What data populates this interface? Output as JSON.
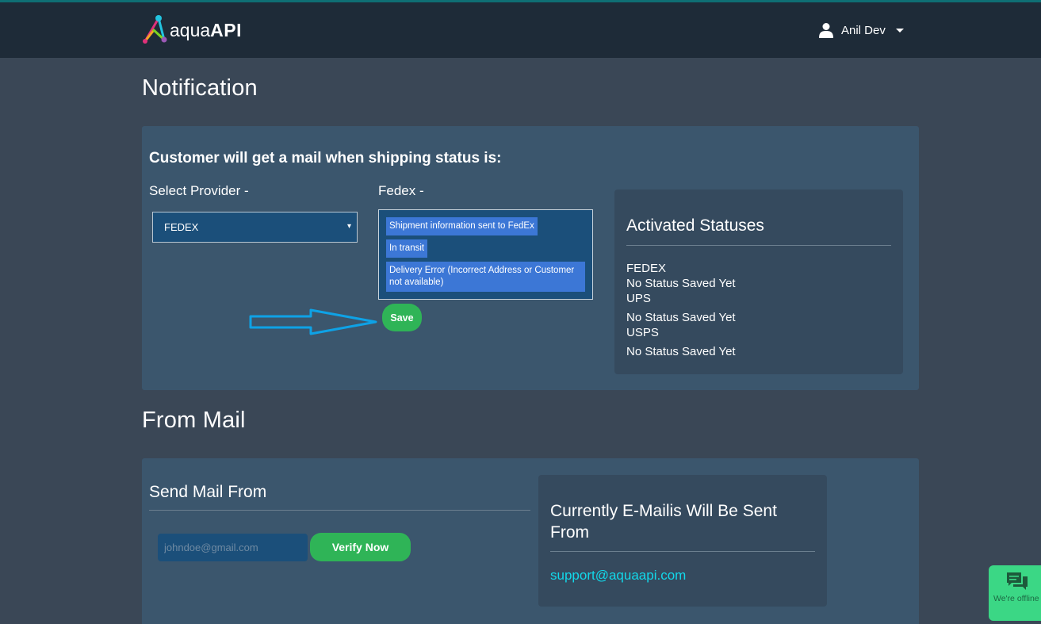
{
  "header": {
    "logo": {
      "prefix": "aqua",
      "suffix": "API"
    },
    "user": {
      "name": "Anil Dev"
    }
  },
  "notification": {
    "heading": "Notification",
    "prompt": "Customer will get a mail when shipping status is:",
    "provider_label": "Select Provider -",
    "provider_selected": "FEDEX",
    "provider_arrow": "▾",
    "statuses_label": "Fedex -",
    "status_options": [
      "Shipment information sent to FedEx",
      "In transit",
      "Delivery Error (Incorrect Address or Customer not available)"
    ],
    "save_label": "Save",
    "activated": {
      "heading": "Activated Statuses",
      "providers": [
        {
          "name": "FEDEX",
          "status": "No Status Saved Yet"
        },
        {
          "name": "UPS",
          "status": "No Status Saved Yet"
        },
        {
          "name": "USPS",
          "status": "No Status Saved Yet"
        }
      ]
    }
  },
  "from_mail": {
    "heading": "From Mail",
    "send_title": "Send Mail From",
    "email_placeholder": "johndoe@gmail.com",
    "verify_label": "Verify Now",
    "current_heading": "Currently E-Mailis Will Be Sent From",
    "current_email": "support@aquaapi.com"
  },
  "chat": {
    "status_text": "We're offline"
  },
  "colors": {
    "accent_green": "#2fb457",
    "link_cyan": "#12d8ea",
    "annotation_arrow": "#0ea2e6",
    "chat_green": "#3bd785"
  }
}
